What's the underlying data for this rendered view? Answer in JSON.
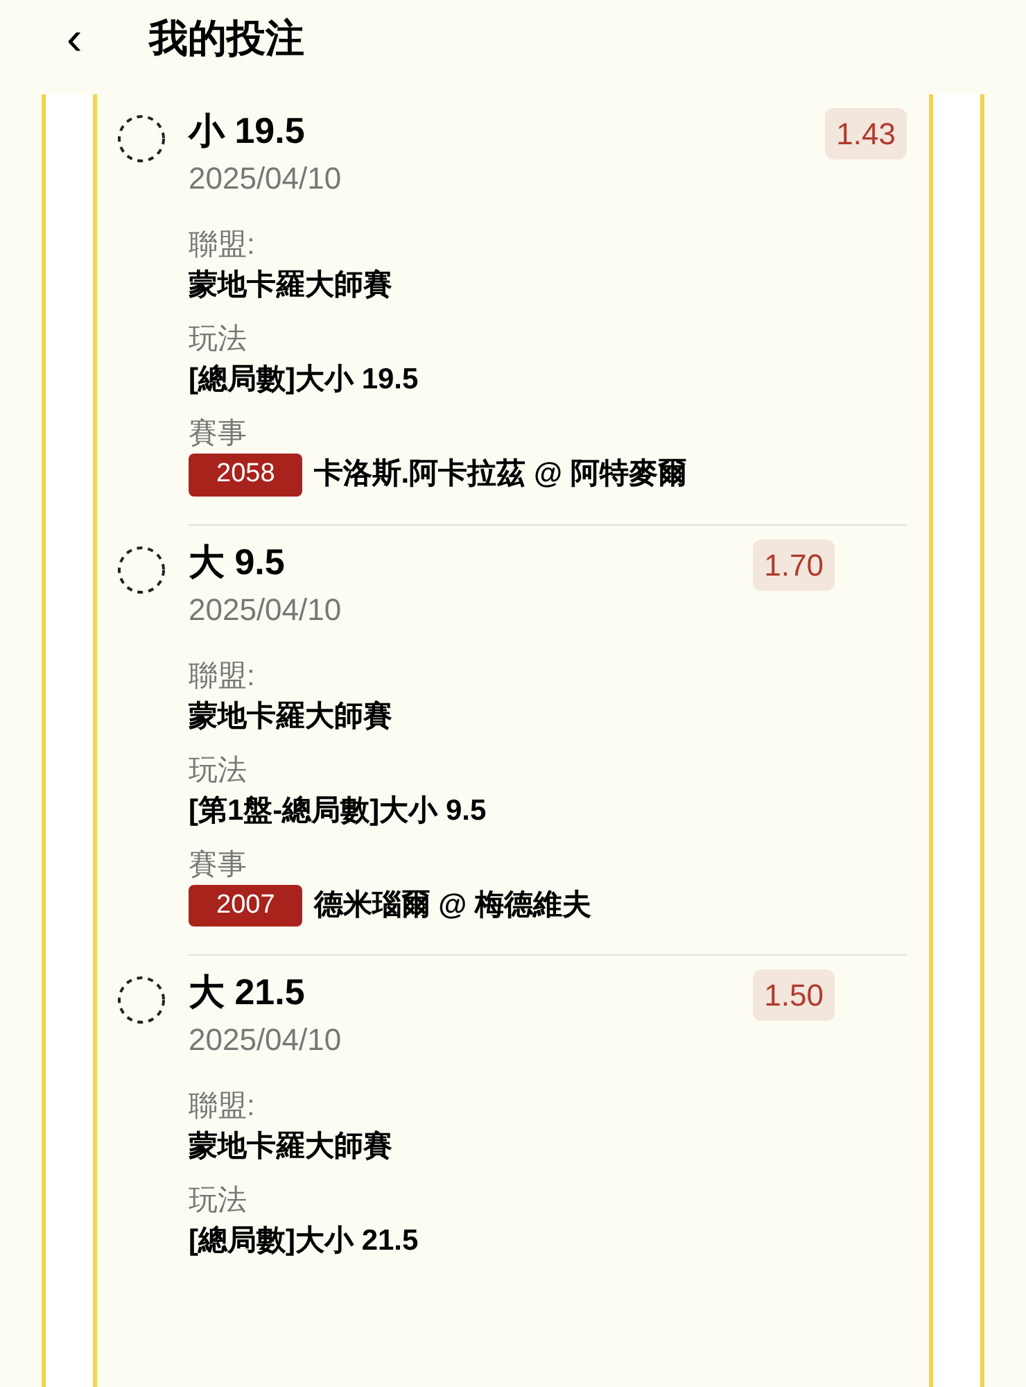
{
  "header": {
    "back": "‹",
    "title": "我的投注"
  },
  "bets": [
    {
      "selection": "小 19.5",
      "date": "2025/04/10",
      "odds": "1.43",
      "selected": false,
      "fields": [
        {
          "label": "聯盟:",
          "value": "蒙地卡羅大師賽"
        },
        {
          "label": "玩法",
          "value": "[總局數]大小 19.5"
        },
        {
          "label": "賽事",
          "match_id": "2058",
          "value": "卡洛斯.阿卡拉茲 @ 阿特麥爾"
        }
      ]
    },
    {
      "selection": "大 9.5",
      "date": "2025/04/10",
      "odds": "1.70",
      "selected": false,
      "fields": [
        {
          "label": "聯盟:",
          "value": "蒙地卡羅大師賽"
        },
        {
          "label": "玩法",
          "value": "[第1盤-總局數]大小 9.5"
        },
        {
          "label": "賽事",
          "match_id": "2007",
          "value": "德米瑙爾 @ 梅德維夫"
        }
      ]
    },
    {
      "selection": "大 21.5",
      "date": "2025/04/10",
      "odds": "1.50",
      "selected": false,
      "fields": [
        {
          "label": "聯盟:",
          "value": "蒙地卡羅大師賽"
        },
        {
          "label": "玩法",
          "value": "[總局數]大小 21.5"
        }
      ]
    }
  ]
}
